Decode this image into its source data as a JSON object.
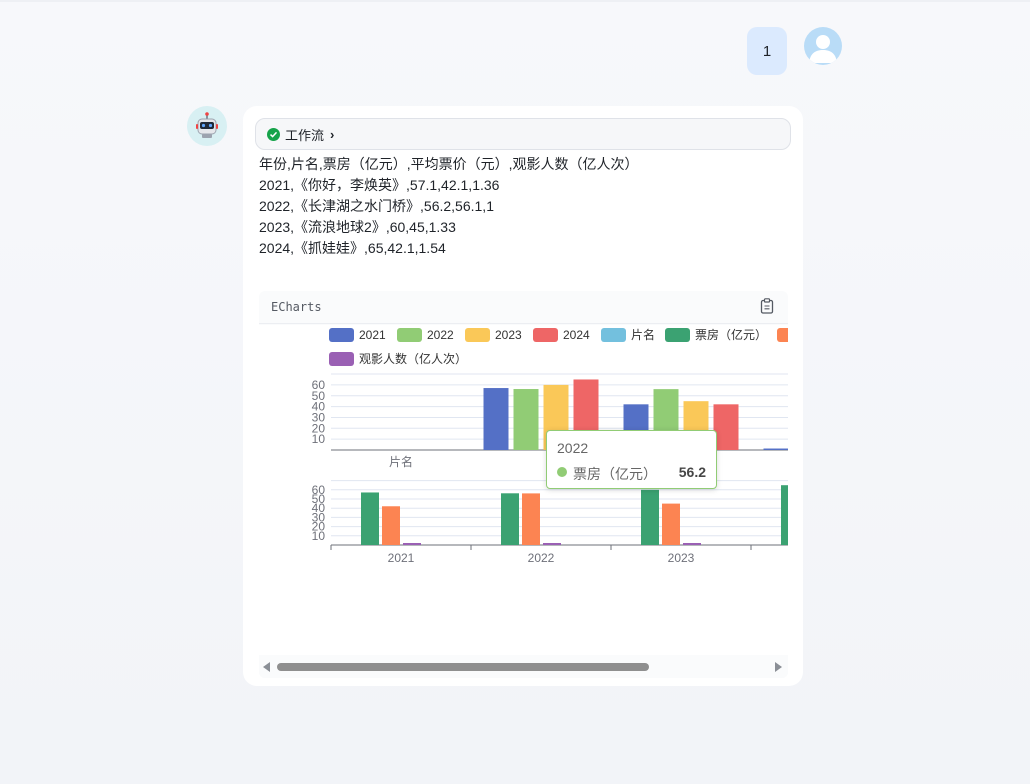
{
  "user": {
    "message": "1"
  },
  "bot": {
    "workflow_label": "工作流",
    "lines": [
      "年份,片名,票房（亿元）,平均票价（元）,观影人数（亿人次）",
      "2021,《你好，李焕英》,57.1,42.1,1.36",
      "2022,《长津湖之水门桥》,56.2,56.1,1",
      "2023,《流浪地球2》,60,45,1.33",
      "2024,《抓娃娃》,65,42.1,1.54"
    ]
  },
  "echarts": {
    "header_label": "ECharts"
  },
  "colors": {
    "blue": "#5470c6",
    "green": "#91cc75",
    "yellow": "#fac858",
    "red": "#ee6666",
    "cyan": "#73c0de",
    "darkgreen": "#3ba272",
    "orange": "#fc8452",
    "purple": "#9a60b4"
  },
  "tooltip": {
    "title": "2022",
    "series_name": "票房（亿元）",
    "value": "56.2"
  },
  "chart_data": [
    {
      "type": "bar",
      "legend": [
        {
          "name": "2021",
          "color": "#5470c6"
        },
        {
          "name": "2022",
          "color": "#91cc75"
        },
        {
          "name": "2023",
          "color": "#fac858"
        },
        {
          "name": "2024",
          "color": "#ee6666"
        },
        {
          "name": "片名",
          "color": "#73c0de"
        },
        {
          "name": "票房（亿元）",
          "color": "#3ba272"
        },
        {
          "name": "",
          "color": "#fc8452"
        },
        {
          "name": "观影人数（亿人次）",
          "color": "#9a60b4"
        }
      ],
      "categories": [
        "片名",
        "票房（亿元）",
        "平均票价（元）",
        "观影人数（亿人次）"
      ],
      "visible_category_labels": [
        "片名"
      ],
      "series": [
        {
          "name": "2021",
          "values": [
            0,
            57.1,
            42.1,
            1.36
          ]
        },
        {
          "name": "2022",
          "values": [
            0,
            56.2,
            56.1,
            1
          ]
        },
        {
          "name": "2023",
          "values": [
            0,
            60,
            45,
            1.33
          ]
        },
        {
          "name": "2024",
          "values": [
            0,
            65,
            42.1,
            1.54
          ]
        }
      ],
      "y_ticks": [
        "10",
        "20",
        "30",
        "40",
        "50",
        "60"
      ],
      "ylim": [
        0,
        70
      ]
    },
    {
      "type": "bar",
      "categories": [
        "2021",
        "2022",
        "2023",
        "2024"
      ],
      "visible_category_labels": [
        "2021",
        "2022",
        "2023"
      ],
      "series": [
        {
          "name": "票房（亿元）",
          "values": [
            57.1,
            56.2,
            60,
            65
          ]
        },
        {
          "name": "平均票价（元）",
          "values": [
            42.1,
            56.1,
            45,
            42.1
          ]
        },
        {
          "name": "观影人数（亿人次）",
          "values": [
            1.36,
            1,
            1.33,
            1.54
          ]
        }
      ],
      "y_ticks": [
        "10",
        "20",
        "30",
        "40",
        "50",
        "60"
      ],
      "ylim": [
        0,
        70
      ]
    }
  ]
}
